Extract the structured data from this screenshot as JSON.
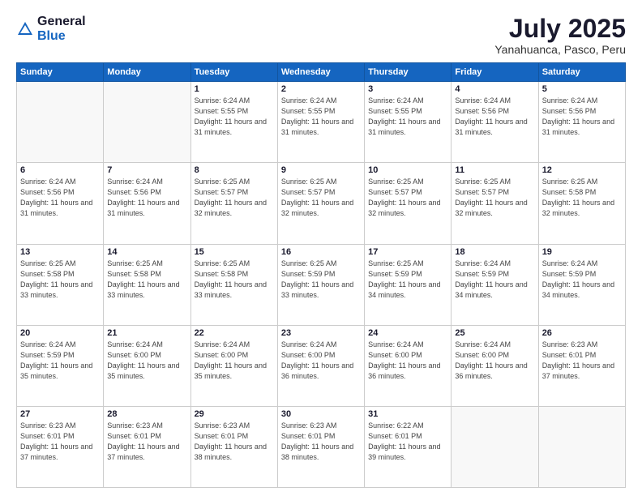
{
  "header": {
    "logo_general": "General",
    "logo_blue": "Blue",
    "month_title": "July 2025",
    "location": "Yanahuanca, Pasco, Peru"
  },
  "weekdays": [
    "Sunday",
    "Monday",
    "Tuesday",
    "Wednesday",
    "Thursday",
    "Friday",
    "Saturday"
  ],
  "weeks": [
    [
      {
        "day": "",
        "info": ""
      },
      {
        "day": "",
        "info": ""
      },
      {
        "day": "1",
        "info": "Sunrise: 6:24 AM\nSunset: 5:55 PM\nDaylight: 11 hours and 31 minutes."
      },
      {
        "day": "2",
        "info": "Sunrise: 6:24 AM\nSunset: 5:55 PM\nDaylight: 11 hours and 31 minutes."
      },
      {
        "day": "3",
        "info": "Sunrise: 6:24 AM\nSunset: 5:55 PM\nDaylight: 11 hours and 31 minutes."
      },
      {
        "day": "4",
        "info": "Sunrise: 6:24 AM\nSunset: 5:56 PM\nDaylight: 11 hours and 31 minutes."
      },
      {
        "day": "5",
        "info": "Sunrise: 6:24 AM\nSunset: 5:56 PM\nDaylight: 11 hours and 31 minutes."
      }
    ],
    [
      {
        "day": "6",
        "info": "Sunrise: 6:24 AM\nSunset: 5:56 PM\nDaylight: 11 hours and 31 minutes."
      },
      {
        "day": "7",
        "info": "Sunrise: 6:24 AM\nSunset: 5:56 PM\nDaylight: 11 hours and 31 minutes."
      },
      {
        "day": "8",
        "info": "Sunrise: 6:25 AM\nSunset: 5:57 PM\nDaylight: 11 hours and 32 minutes."
      },
      {
        "day": "9",
        "info": "Sunrise: 6:25 AM\nSunset: 5:57 PM\nDaylight: 11 hours and 32 minutes."
      },
      {
        "day": "10",
        "info": "Sunrise: 6:25 AM\nSunset: 5:57 PM\nDaylight: 11 hours and 32 minutes."
      },
      {
        "day": "11",
        "info": "Sunrise: 6:25 AM\nSunset: 5:57 PM\nDaylight: 11 hours and 32 minutes."
      },
      {
        "day": "12",
        "info": "Sunrise: 6:25 AM\nSunset: 5:58 PM\nDaylight: 11 hours and 32 minutes."
      }
    ],
    [
      {
        "day": "13",
        "info": "Sunrise: 6:25 AM\nSunset: 5:58 PM\nDaylight: 11 hours and 33 minutes."
      },
      {
        "day": "14",
        "info": "Sunrise: 6:25 AM\nSunset: 5:58 PM\nDaylight: 11 hours and 33 minutes."
      },
      {
        "day": "15",
        "info": "Sunrise: 6:25 AM\nSunset: 5:58 PM\nDaylight: 11 hours and 33 minutes."
      },
      {
        "day": "16",
        "info": "Sunrise: 6:25 AM\nSunset: 5:59 PM\nDaylight: 11 hours and 33 minutes."
      },
      {
        "day": "17",
        "info": "Sunrise: 6:25 AM\nSunset: 5:59 PM\nDaylight: 11 hours and 34 minutes."
      },
      {
        "day": "18",
        "info": "Sunrise: 6:24 AM\nSunset: 5:59 PM\nDaylight: 11 hours and 34 minutes."
      },
      {
        "day": "19",
        "info": "Sunrise: 6:24 AM\nSunset: 5:59 PM\nDaylight: 11 hours and 34 minutes."
      }
    ],
    [
      {
        "day": "20",
        "info": "Sunrise: 6:24 AM\nSunset: 5:59 PM\nDaylight: 11 hours and 35 minutes."
      },
      {
        "day": "21",
        "info": "Sunrise: 6:24 AM\nSunset: 6:00 PM\nDaylight: 11 hours and 35 minutes."
      },
      {
        "day": "22",
        "info": "Sunrise: 6:24 AM\nSunset: 6:00 PM\nDaylight: 11 hours and 35 minutes."
      },
      {
        "day": "23",
        "info": "Sunrise: 6:24 AM\nSunset: 6:00 PM\nDaylight: 11 hours and 36 minutes."
      },
      {
        "day": "24",
        "info": "Sunrise: 6:24 AM\nSunset: 6:00 PM\nDaylight: 11 hours and 36 minutes."
      },
      {
        "day": "25",
        "info": "Sunrise: 6:24 AM\nSunset: 6:00 PM\nDaylight: 11 hours and 36 minutes."
      },
      {
        "day": "26",
        "info": "Sunrise: 6:23 AM\nSunset: 6:01 PM\nDaylight: 11 hours and 37 minutes."
      }
    ],
    [
      {
        "day": "27",
        "info": "Sunrise: 6:23 AM\nSunset: 6:01 PM\nDaylight: 11 hours and 37 minutes."
      },
      {
        "day": "28",
        "info": "Sunrise: 6:23 AM\nSunset: 6:01 PM\nDaylight: 11 hours and 37 minutes."
      },
      {
        "day": "29",
        "info": "Sunrise: 6:23 AM\nSunset: 6:01 PM\nDaylight: 11 hours and 38 minutes."
      },
      {
        "day": "30",
        "info": "Sunrise: 6:23 AM\nSunset: 6:01 PM\nDaylight: 11 hours and 38 minutes."
      },
      {
        "day": "31",
        "info": "Sunrise: 6:22 AM\nSunset: 6:01 PM\nDaylight: 11 hours and 39 minutes."
      },
      {
        "day": "",
        "info": ""
      },
      {
        "day": "",
        "info": ""
      }
    ]
  ]
}
